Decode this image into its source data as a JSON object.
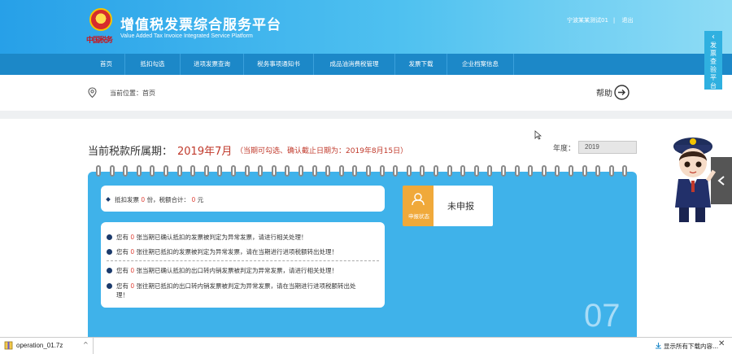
{
  "header": {
    "title": "增值税发票综合服务平台",
    "subtitle": "Value Added Tax Invoice Integrated Service Platform",
    "emblem_text": "中国税务",
    "user": "宁波某某测试01",
    "logout": "退出"
  },
  "nav": {
    "items": [
      {
        "label": "首页"
      },
      {
        "label": "抵扣勾选"
      },
      {
        "label": "进项发票查询"
      },
      {
        "label": "税务事项通知书"
      },
      {
        "label": "成品油消费税管理"
      },
      {
        "label": "发票下载"
      },
      {
        "label": "企业档案信息"
      }
    ]
  },
  "breadcrumb": {
    "text": "当前位置：首页",
    "help": "帮助"
  },
  "period": {
    "label": "当前税款所属期：",
    "value": "2019年7月",
    "note": "（当期可勾选、确认截止日期为：2019年8月15日）",
    "year_label": "年度：",
    "year_value": "2019"
  },
  "summary": {
    "row1_prefix": "抵扣发票",
    "row1_count": "0",
    "row1_mid": "份，税额合计：",
    "row1_amount": "0",
    "row1_suffix": "元"
  },
  "notices": [
    {
      "pre": "您有",
      "num": "0",
      "post": "张当期已确认抵扣的发票被判定为异常发票，请进行相关处理！"
    },
    {
      "pre": "您有",
      "num": "0",
      "post": "张往期已抵扣的发票被判定为异常发票，请在当期进行进项税额转出处理！"
    },
    {
      "pre": "您有",
      "num": "0",
      "post": "张当期已确认抵扣的出口转内销发票被判定为异常发票，请进行相关处理！"
    },
    {
      "pre": "您有",
      "num": "0",
      "post": "张往期已抵扣的出口转内销发票被判定为异常发票，请在当期进行进项税额转出处",
      "line2": "理！"
    }
  ],
  "status": {
    "label": "申报状态",
    "value": "未申报"
  },
  "calendar": {
    "month": "07"
  },
  "side_tab": {
    "label": "发票查验平台",
    "arrow": "‹"
  },
  "download": {
    "file": "operation_01.7z",
    "show_all": "显示所有下载内容...",
    "close": "✕"
  },
  "colors": {
    "header": "#27a0e8",
    "nav": "#1c88c8",
    "calendar": "#3fb2ea",
    "accent_red": "#c0392b",
    "status_orange": "#f0a93a"
  }
}
